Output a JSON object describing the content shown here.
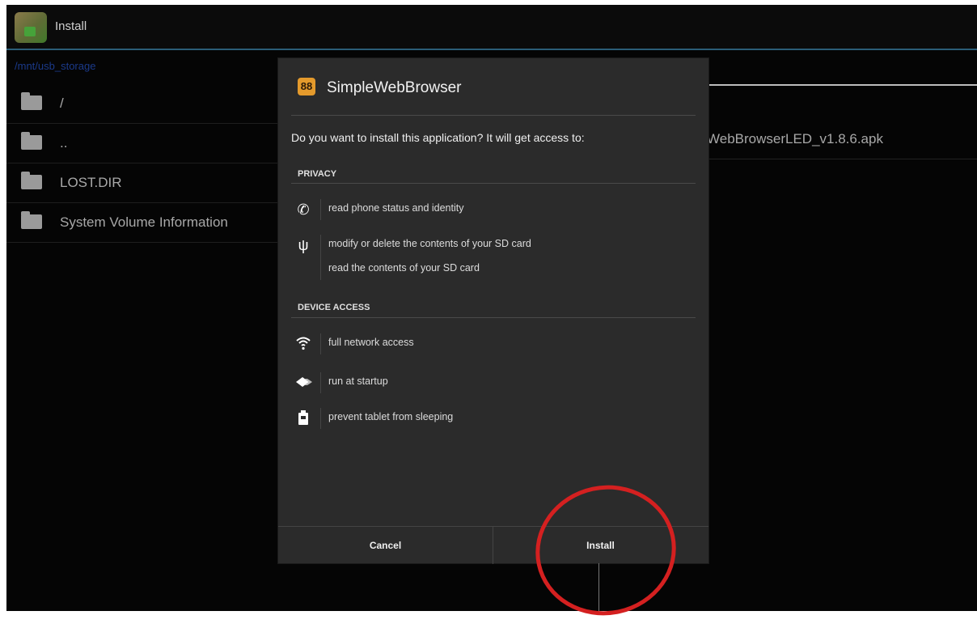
{
  "actionbar": {
    "title": "Install"
  },
  "path": {
    "text": "/mnt/usb_storage"
  },
  "files": [
    {
      "name": "/"
    },
    {
      "name": ".."
    },
    {
      "name": "LOST.DIR"
    },
    {
      "name": "System Volume Information"
    }
  ],
  "background": {
    "apk_name": "WebBrowserLED_v1.8.6.apk"
  },
  "dialog": {
    "app_name": "SimpleWebBrowser",
    "app_icon_glyph": "88",
    "question": "Do you want to install this application? It will get access to:",
    "sections": [
      {
        "label": "PRIVACY",
        "permissions": [
          {
            "icon": "phone-icon",
            "text": "read phone status and identity"
          },
          {
            "icon": "usb-icon",
            "text": "modify or delete the contents of your SD card",
            "text2": "read the contents of your SD card"
          }
        ]
      },
      {
        "label": "DEVICE ACCESS",
        "permissions": [
          {
            "icon": "wifi-icon",
            "text": "full network access"
          },
          {
            "icon": "startup-icon",
            "text": "run at startup"
          },
          {
            "icon": "battery-lock-icon",
            "text": "prevent tablet from sleeping"
          }
        ]
      }
    ],
    "buttons": {
      "cancel": "Cancel",
      "install": "Install"
    }
  }
}
